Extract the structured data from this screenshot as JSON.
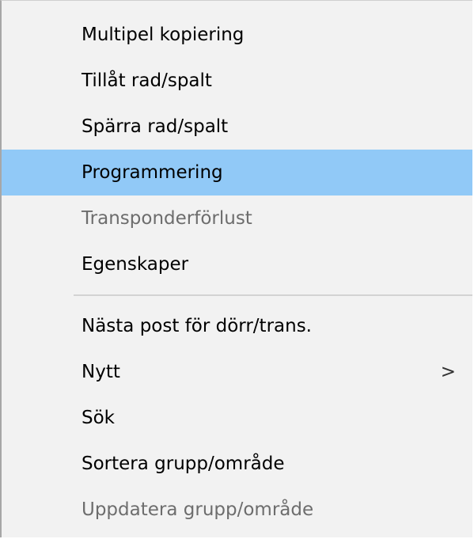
{
  "context_menu": {
    "group_one": [
      {
        "label": "Multipel kopiering",
        "state": "normal"
      },
      {
        "label": "Tillåt rad/spalt",
        "state": "normal"
      },
      {
        "label": "Spärra rad/spalt",
        "state": "normal"
      },
      {
        "label": "Programmering",
        "state": "highlighted"
      },
      {
        "label": "Transponderförlust",
        "state": "disabled"
      },
      {
        "label": "Egenskaper",
        "state": "normal"
      }
    ],
    "group_two": [
      {
        "label": "Nästa post för dörr/trans.",
        "state": "normal"
      },
      {
        "label": "Nytt",
        "state": "normal",
        "submenu_arrow": ">"
      },
      {
        "label": "Sök",
        "state": "normal"
      },
      {
        "label": "Sortera grupp/område",
        "state": "normal"
      },
      {
        "label": "Uppdatera grupp/område",
        "state": "disabled"
      }
    ]
  },
  "colors": {
    "menu_background": "#f2f2f2",
    "highlight": "#91c9f7",
    "text": "#000000",
    "disabled_text": "#6d6d6d",
    "separator": "#d3d3d3"
  }
}
